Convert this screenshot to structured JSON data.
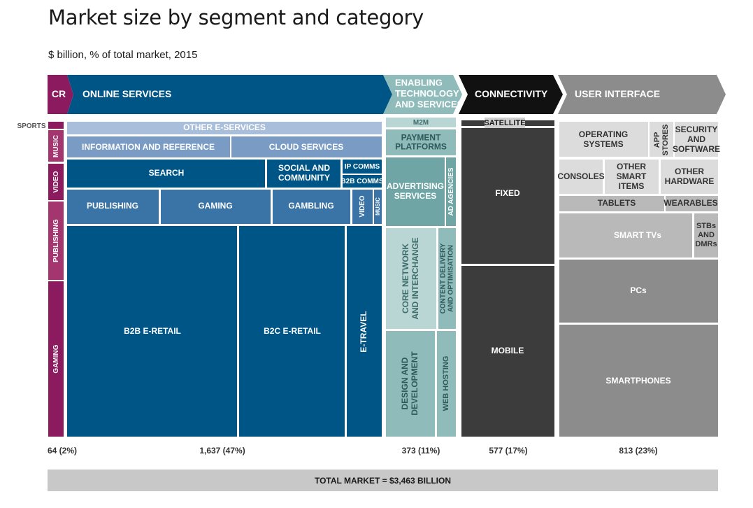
{
  "page": {
    "title": "Market size by segment and category",
    "subtitle": "$ billion, % of total market, 2015",
    "total_label": "TOTAL MARKET = $3,463 BILLION"
  },
  "colors": {
    "cr": "#8c1a5e",
    "cr_light": "#a3356f",
    "online": "#005587",
    "online_mid": "#3a73a6",
    "online_light": "#7a9cc4",
    "online_lighter": "#a9bedb",
    "enabling": "#8fbcbb",
    "enabling_light": "#b9d6d4",
    "enabling_dark": "#6fa5a4",
    "connectivity": "#3c3c3c",
    "connectivity_dark": "#2a2a2a",
    "ui": "#8c8c8c",
    "ui_light": "#b9b9b9",
    "ui_lighter": "#dcdcdc"
  },
  "chart_data": {
    "type": "treemap",
    "units": "$ billion, % of total market, 2015",
    "total": {
      "value": 3463,
      "label": "TOTAL MARKET = $3,463 BILLION"
    },
    "segments": [
      {
        "name": "CR",
        "value": 64,
        "share_pct": 2,
        "footer": "64 (2%)",
        "categories": [
          "SPORTS",
          "MUSIC",
          "VIDEO",
          "PUBLISHING",
          "GAMING"
        ]
      },
      {
        "name": "ONLINE SERVICES",
        "value": 1637,
        "share_pct": 47,
        "footer": "1,637 (47%)",
        "categories": [
          "OTHER E-SERVICES",
          "INFORMATION AND REFERENCE",
          "CLOUD SERVICES",
          "SEARCH",
          "SOCIAL AND COMMUNITY",
          "IP COMMS",
          "B2B COMMS",
          "PUBLISHING",
          "GAMING",
          "GAMBLING",
          "VIDEO",
          "MUSIC",
          "B2B E-RETAIL",
          "B2C E-RETAIL",
          "E-TRAVEL"
        ]
      },
      {
        "name": "ENABLING TECHNOLOGY AND SERVICES",
        "value": 373,
        "share_pct": 11,
        "footer": "373 (11%)",
        "categories": [
          "M2M",
          "PAYMENT PLATFORMS",
          "ADVERTISING SERVICES",
          "AD AGENCIES",
          "CORE NETWORK AND INTERCHANGE",
          "CONTENT DELIVERY AND OPTIMISATION",
          "DESIGN AND DEVELOPMENT",
          "WEB HOSTING"
        ]
      },
      {
        "name": "CONNECTIVITY",
        "value": 577,
        "share_pct": 17,
        "footer": "577 (17%)",
        "categories": [
          "SATELLITE",
          "FIXED",
          "MOBILE"
        ]
      },
      {
        "name": "USER INTERFACE",
        "value": 813,
        "share_pct": 23,
        "footer": "813 (23%)",
        "categories": [
          "OPERATING SYSTEMS",
          "APP STORES",
          "SECURITY AND SOFTWARE",
          "CONSOLES",
          "OTHER SMART ITEMS",
          "OTHER HARDWARE",
          "TABLETS",
          "WEARABLES",
          "SMART TVs",
          "STBs AND DMRs",
          "PCs",
          "SMARTPHONES"
        ]
      }
    ],
    "labels": {
      "cr": "CR",
      "online": "ONLINE SERVICES",
      "enabling": [
        "ENABLING",
        "TECHNOLOGY",
        "AND SERVICES"
      ],
      "connectivity": "CONNECTIVITY",
      "ui": "USER INTERFACE",
      "sports": "SPORTS",
      "music": "MUSIC",
      "video": "VIDEO",
      "publishing": "PUBLISHING",
      "gaming": "GAMING",
      "other_eservices": "OTHER E-SERVICES",
      "info_ref": "INFORMATION AND REFERENCE",
      "cloud": "CLOUD SERVICES",
      "search": "SEARCH",
      "social": [
        "SOCIAL AND",
        "COMMUNITY"
      ],
      "ipcomms": "IP COMMS",
      "b2bcomms": "B2B COMMS",
      "os_publishing": "PUBLISHING",
      "os_gaming": "GAMING",
      "gambling": "GAMBLING",
      "os_video": "VIDEO",
      "os_music": "MUSIC",
      "b2b_eretail": "B2B E-RETAIL",
      "b2c_eretail": "B2C E-RETAIL",
      "etravel": "E-TRAVEL",
      "m2m": "M2M",
      "payment": [
        "PAYMENT",
        "PLATFORMS"
      ],
      "advertising": [
        "ADVERTISING",
        "SERVICES"
      ],
      "adagencies": "AD AGENCIES",
      "corenet": [
        "CORE NETWORK",
        "AND INTERCHANGE"
      ],
      "contentdel": [
        "CONTENT DELIVERY",
        "AND OPTIMISATION"
      ],
      "design": [
        "DESIGN AND",
        "DEVELOPMENT"
      ],
      "webhosting": "WEB HOSTING",
      "satellite": "SATELLITE",
      "fixed": "FIXED",
      "mobile": "MOBILE",
      "opsys": [
        "OPERATING",
        "SYSTEMS"
      ],
      "appstores": [
        "APP",
        "STORES"
      ],
      "security": [
        "SECURITY",
        "AND",
        "SOFTWARE"
      ],
      "consoles": "CONSOLES",
      "othersmart": [
        "OTHER",
        "SMART",
        "ITEMS"
      ],
      "otherhw": [
        "OTHER",
        "HARDWARE"
      ],
      "tablets": "TABLETS",
      "wearables": "WEARABLES",
      "smarttvs": "SMART TVs",
      "stbs": [
        "STBs",
        "AND",
        "DMRs"
      ],
      "pcs": "PCs",
      "smartphones": "SMARTPHONES"
    }
  }
}
